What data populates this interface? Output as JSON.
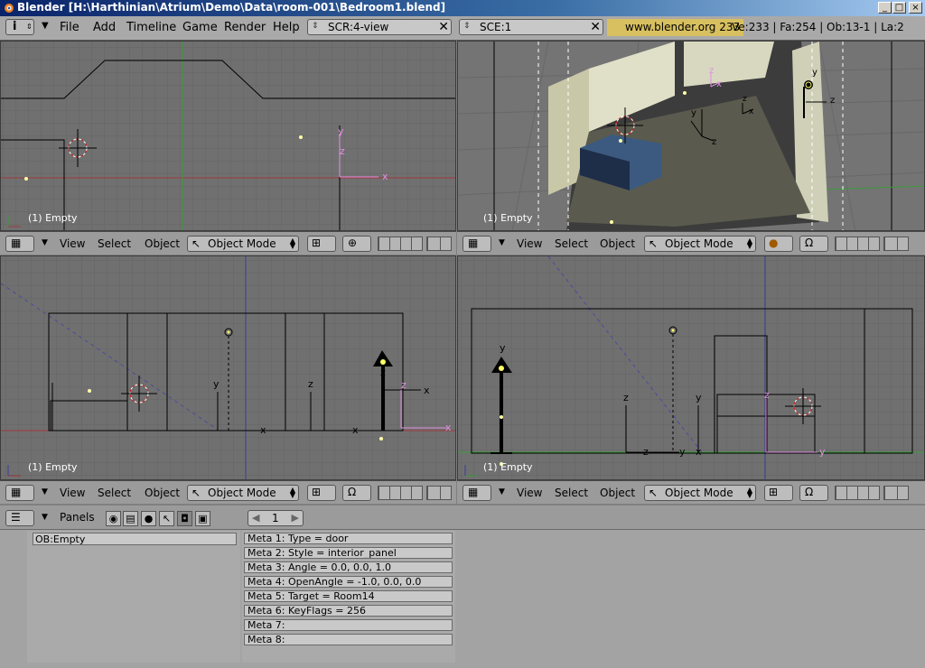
{
  "window": {
    "title": "Blender [H:\\Harthinian\\Atrium\\Demo\\Data\\room-001\\Bedroom1.blend]",
    "controls": [
      "_",
      "□",
      "×"
    ]
  },
  "topmenu": {
    "items": [
      "File",
      "Add",
      "Timeline",
      "Game",
      "Render",
      "Help"
    ],
    "screen_field": "SCR:4-view",
    "scene_field": "SCE:1",
    "site": "www.blender.org 233",
    "stats": "Ve:233 | Fa:254 | Ob:13-1 | La:2"
  },
  "viewports": [
    {
      "label": "(1) Empty",
      "menus": [
        "View",
        "Select",
        "Object"
      ],
      "mode": "Object Mode",
      "axes": "x-y"
    },
    {
      "label": "(1) Empty",
      "menus": [
        "View",
        "Select",
        "Object"
      ],
      "mode": "Object Mode",
      "axes": "persp"
    },
    {
      "label": "(1) Empty",
      "menus": [
        "View",
        "Select",
        "Object"
      ],
      "mode": "Object Mode",
      "axes": "x-z"
    },
    {
      "label": "(1) Empty",
      "menus": [
        "View",
        "Select",
        "Object"
      ],
      "mode": "Object Mode",
      "axes": "y-z"
    }
  ],
  "buttons_window": {
    "panels_label": "Panels",
    "page_number": "1",
    "object_name": "OB:Empty",
    "meta": [
      "Meta 1: Type =  door",
      "Meta 2: Style = interior_panel",
      "Meta 3: Angle = 0.0, 0.0, 1.0",
      "Meta 4: OpenAngle = -1.0, 0.0, 0.0",
      "Meta 5: Target = Room14",
      "Meta 6: KeyFlags = 256",
      "Meta 7:",
      "Meta 8:"
    ]
  },
  "colors": {
    "viewport_bg": "#707070",
    "grid": "#626262",
    "axis_x": "#a0383c",
    "axis_y": "#3a9a3a",
    "axis_z": "#3d3d9e",
    "empty_pink": "#e090e0",
    "site_bg": "#d8c060"
  }
}
